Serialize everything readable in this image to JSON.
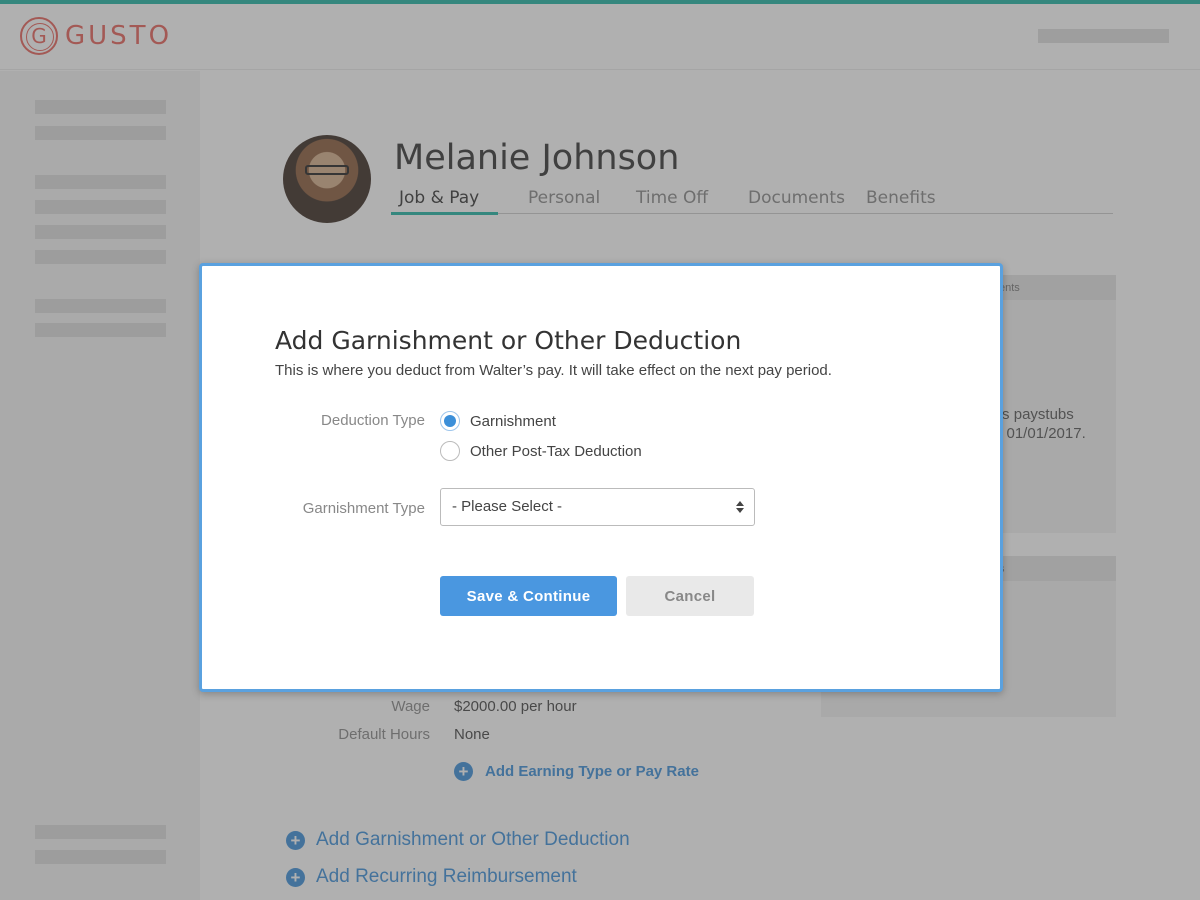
{
  "brand": {
    "logo_letter": "G",
    "logo_text": "GUSTO"
  },
  "profile": {
    "name": "Melanie Johnson",
    "tabs": [
      {
        "label": "Job & Pay",
        "active": true
      },
      {
        "label": "Personal"
      },
      {
        "label": "Time Off"
      },
      {
        "label": "Documents"
      },
      {
        "label": "Benefits"
      }
    ]
  },
  "background": {
    "card1_header": "ents",
    "card1_text_line1": "’s paystubs",
    "card1_text_line2": "l 01/01/2017.",
    "card2_header": "s",
    "wage_label": "Wage",
    "wage_value": "$2000.00 per hour",
    "hours_label": "Default Hours",
    "hours_value": "None",
    "add_earning": "Add Earning Type or Pay Rate",
    "add_garnishment": "Add Garnishment or Other Deduction",
    "add_reimbursement": "Add Recurring Reimbursement"
  },
  "modal": {
    "title": "Add Garnishment or Other Deduction",
    "subtitle": "This is where you deduct from Walter’s pay. It will take effect on the next pay period.",
    "deduction_type_label": "Deduction Type",
    "deduction_options": [
      {
        "label": "Garnishment",
        "checked": true
      },
      {
        "label": "Other Post-Tax Deduction",
        "checked": false
      }
    ],
    "garnishment_type_label": "Garnishment Type",
    "garnishment_select_value": "- Please Select -",
    "save_label": "Save & Continue",
    "cancel_label": "Cancel"
  },
  "colors": {
    "accent": "#1fb5a4",
    "brand": "#e8625a",
    "primary": "#4a97e0",
    "link": "#3b8fd9"
  }
}
